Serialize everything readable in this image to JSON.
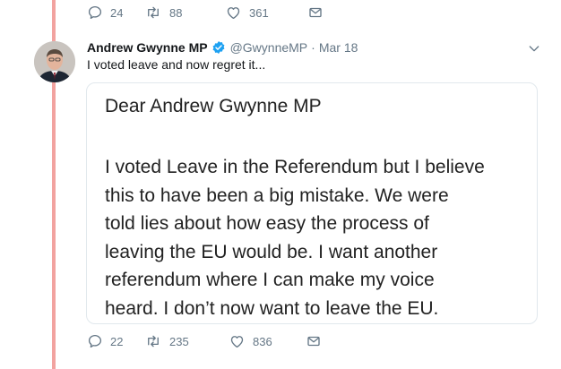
{
  "previous_tweet": {
    "reply_count": "24",
    "retweet_count": "88",
    "like_count": "361"
  },
  "tweet": {
    "author_name": "Andrew Gwynne MP",
    "handle": "@GwynneMP",
    "separator": "·",
    "date": "Mar 18",
    "text": "I voted leave and now regret it...",
    "verified": true,
    "reply_count": "22",
    "retweet_count": "235",
    "like_count": "836"
  },
  "letter": {
    "greeting": "Dear Andrew Gwynne MP",
    "lines": [
      "I voted Leave in the Referendum but I believe",
      "this to have been a big mistake. We were",
      "told lies about how easy the process of",
      "leaving the EU would be. I want another",
      "referendum where I can make my voice",
      "heard. I don’t now want to leave the EU."
    ]
  },
  "colors": {
    "thread_line": "#f2a3a0",
    "verified_badge": "#1da1f2",
    "muted_text": "#657786"
  },
  "icons": [
    "reply-icon",
    "retweet-icon",
    "like-icon",
    "direct-message-icon",
    "verified-badge-icon",
    "chevron-down-icon"
  ]
}
